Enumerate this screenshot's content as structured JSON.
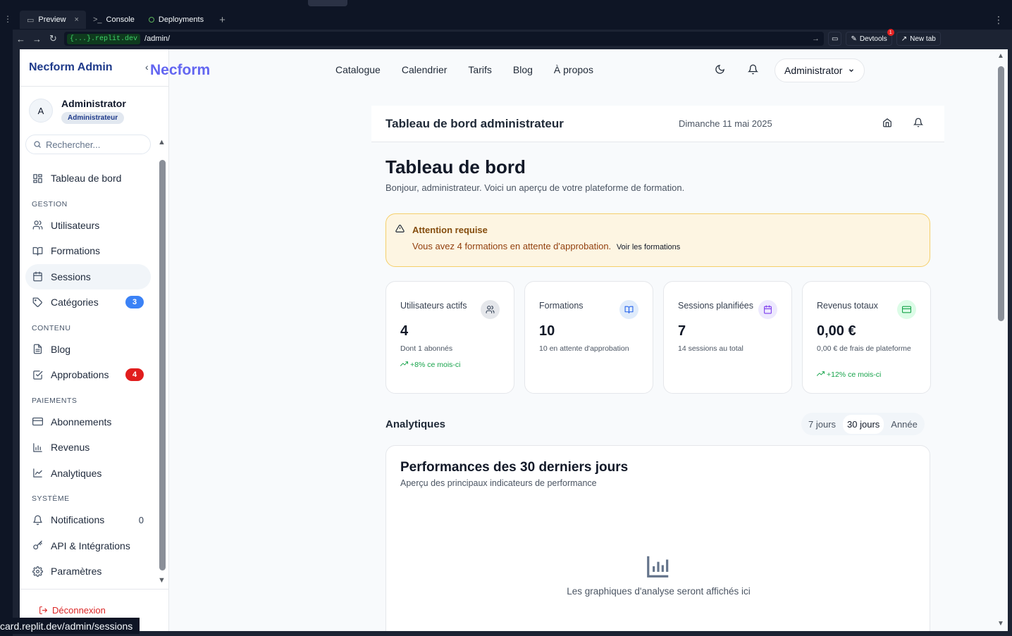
{
  "browser": {
    "tabs": [
      {
        "label": "Preview"
      },
      {
        "label": "Console"
      },
      {
        "label": "Deployments"
      }
    ],
    "url_host": "{...}.replit.dev",
    "url_path": "/admin/",
    "devtools_label": "Devtools",
    "devtools_badge": "1",
    "new_tab_label": "New tab",
    "status_url": "card.replit.dev/admin/sessions"
  },
  "sidebar": {
    "brand": "Necform Admin",
    "user": {
      "initial": "A",
      "name": "Administrator",
      "role": "Administrateur"
    },
    "search_placeholder": "Rechercher...",
    "sections": [
      {
        "title": "",
        "items": [
          {
            "label": "Tableau de bord",
            "icon": "dashboard-icon"
          }
        ]
      },
      {
        "title": "GESTION",
        "items": [
          {
            "label": "Utilisateurs",
            "icon": "users-icon"
          },
          {
            "label": "Formations",
            "icon": "book-icon"
          },
          {
            "label": "Sessions",
            "icon": "calendar-icon",
            "active": true
          },
          {
            "label": "Catégories",
            "icon": "tag-icon",
            "badge": "3",
            "badge_color": "#3b82f6"
          }
        ]
      },
      {
        "title": "CONTENU",
        "items": [
          {
            "label": "Blog",
            "icon": "file-text-icon"
          },
          {
            "label": "Approbations",
            "icon": "check-square-icon",
            "badge": "4",
            "badge_color": "#e11d1d"
          }
        ]
      },
      {
        "title": "PAIEMENTS",
        "items": [
          {
            "label": "Abonnements",
            "icon": "credit-card-icon"
          },
          {
            "label": "Revenus",
            "icon": "bar-chart-icon"
          },
          {
            "label": "Analytiques",
            "icon": "line-chart-icon"
          }
        ]
      },
      {
        "title": "SYSTÈME",
        "items": [
          {
            "label": "Notifications",
            "icon": "bell-icon",
            "count": "0"
          },
          {
            "label": "API & Intégrations",
            "icon": "key-icon"
          },
          {
            "label": "Paramètres",
            "icon": "settings-icon"
          }
        ]
      }
    ],
    "logout_label": "Déconnexion"
  },
  "topnav": {
    "logo": "Necform",
    "links": [
      "Catalogue",
      "Calendrier",
      "Tarifs",
      "Blog",
      "À propos"
    ],
    "user_menu_label": "Administrator"
  },
  "header": {
    "title": "Tableau de bord administrateur",
    "date": "Dimanche 11 mai 2025"
  },
  "page": {
    "title": "Tableau de bord",
    "subtitle": "Bonjour, administrateur. Voici un aperçu de votre plateforme de formation."
  },
  "alert": {
    "title": "Attention requise",
    "message": "Vous avez 4 formations en attente d'approbation.",
    "link": "Voir les formations"
  },
  "stats": [
    {
      "label": "Utilisateurs actifs",
      "value": "4",
      "note": "Dont 1 abonnés",
      "trend": "+8% ce mois-ci",
      "icon": "users-icon",
      "icon_bg": "#e5e7eb",
      "icon_color": "#334155"
    },
    {
      "label": "Formations",
      "value": "10",
      "note": "10 en attente d'approbation",
      "trend": "",
      "icon": "book-icon",
      "icon_bg": "#e0ecfb",
      "icon_color": "#2563eb"
    },
    {
      "label": "Sessions planifiées",
      "value": "7",
      "note": "14 sessions au total",
      "trend": "",
      "icon": "calendar-icon",
      "icon_bg": "#ede9fe",
      "icon_color": "#7c3aed"
    },
    {
      "label": "Revenus totaux",
      "value": "0,00 €",
      "note": "0,00 € de frais de plateforme",
      "trend": "+12% ce mois-ci",
      "icon": "credit-card-icon",
      "icon_bg": "#dcfce7",
      "icon_color": "#16a34a"
    }
  ],
  "analytics": {
    "title": "Analytiques",
    "periods": [
      "7 jours",
      "30 jours",
      "Année"
    ],
    "active_period": "30 jours",
    "card_title": "Performances des 30 derniers jours",
    "card_subtitle": "Aperçu des principaux indicateurs de performance",
    "empty_message": "Les graphiques d'analyse seront affichés ici"
  }
}
